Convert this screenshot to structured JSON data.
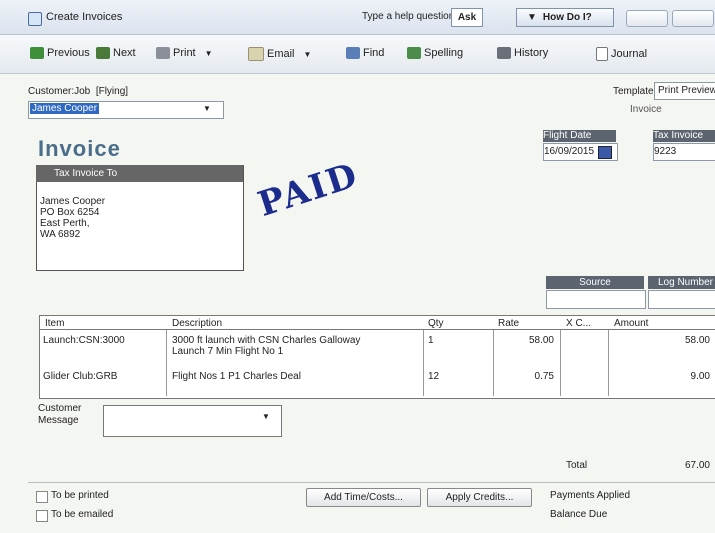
{
  "window": {
    "title": "Create Invoices",
    "help_placeholder": "Type a help question",
    "ask_label": "Ask",
    "howdoi_label": "How Do I?"
  },
  "toolbar": {
    "previous": "Previous",
    "next": "Next",
    "print": "Print",
    "email": "Email",
    "find": "Find",
    "spelling": "Spelling",
    "history": "History",
    "journal": "Journal"
  },
  "header": {
    "customer_job_label": "Customer:Job",
    "customer_job_sub": "[Flying]",
    "customer_job_value": "James Cooper",
    "template_label": "Template",
    "template_value": "Print Preview",
    "template_sub": "Invoice",
    "form_title": "Invoice",
    "stamp": "PAID"
  },
  "billto": {
    "heading": "Tax Invoice To",
    "lines": [
      "James Cooper",
      "PO Box 6254",
      "East Perth,",
      "WA 6892"
    ]
  },
  "fields": {
    "flight_date_label": "Flight Date",
    "flight_date_value": "16/09/2015",
    "tax_invoice_label": "Tax Invoice",
    "tax_invoice_value": "9223",
    "source_label": "Source",
    "log_number_label": "Log Number"
  },
  "table": {
    "columns": [
      "Item",
      "Description",
      "Qty",
      "Rate",
      "X C...",
      "Amount"
    ],
    "rows": [
      {
        "item": "Launch:CSN:3000",
        "description": [
          "3000 ft launch with CSN Charles Galloway",
          "Launch 7 Min Flight No 1"
        ],
        "qty": "1",
        "rate": "58.00",
        "amount": "58.00"
      },
      {
        "item": "Glider Club:GRB",
        "description": [
          "Flight Nos 1 P1 Charles Deal"
        ],
        "qty": "12",
        "rate": "0.75",
        "amount": "9.00"
      }
    ]
  },
  "footer": {
    "customer_message_label_1": "Customer",
    "customer_message_label_2": "Message",
    "total_label": "Total",
    "total_value": "67.00",
    "to_be_printed": "To be printed",
    "to_be_emailed": "To be emailed",
    "add_time_costs": "Add Time/Costs...",
    "apply_credits": "Apply Credits...",
    "payments_applied": "Payments Applied",
    "balance_due": "Balance Due"
  },
  "colors": {
    "accent": "#316ac5",
    "header_bar": "#5c6470",
    "stamp": "#1c2c8c",
    "form_title": "#4a6e8a"
  }
}
